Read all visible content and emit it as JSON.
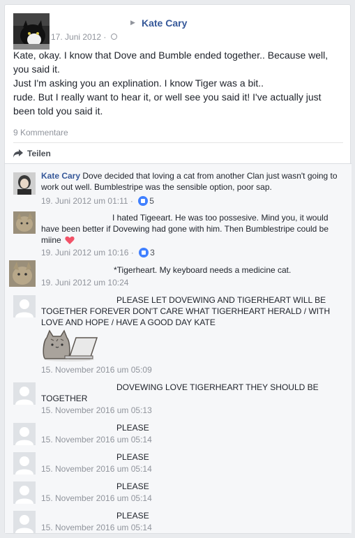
{
  "post": {
    "author": "Kate Cary",
    "date": "17. Juni 2012",
    "separator": "·",
    "body": [
      "Kate, okay. I know that Dove and Bumble ended together.. Because well, you said it.",
      "Just I'm asking you an explination. I know Tiger was a bit..",
      "rude. But I really want to hear it, or well see you said it! I've actually just been told you said it."
    ],
    "comment_count": "9 Kommentare",
    "share_label": "Teilen"
  },
  "comments": [
    {
      "author": "Kate Cary",
      "text": "Dove decided that loving a cat from another Clan just wasn't going to work out well. Bumblestripe was the sensible option, poor sap.",
      "time": "19. Juni 2012 um 01:11",
      "separator": "·",
      "likes": "5"
    },
    {
      "author": "",
      "text": "I hated Tigeeart. He was too possesive. Mind you, it would have been better if Dovewing had gone with him. Then Bumblestripe could be miine",
      "time": "19. Juni 2012 um 10:16",
      "separator": "·",
      "likes": "3"
    },
    {
      "author": "",
      "text": "*Tigerheart. My keyboard needs a medicine cat.",
      "time": "19. Juni 2012 um 10:24"
    },
    {
      "author": "",
      "text": "PLEASE LET DOVEWING AND TIGERHEART WILL BE TOGETHER FOREVER DON'T CARE WHAT TIGERHEART HERALD / WITH LOVE AND HOPE / HAVE A GOOD DAY KATE",
      "time": "15. November 2016 um 05:09"
    },
    {
      "author": "",
      "text": "DOVEWING LOVE TIGERHEART THEY SHOULD BE TOGETHER",
      "time": "15. November 2016 um 05:13"
    },
    {
      "author": "",
      "text": "PLEASE",
      "time": "15. November 2016 um 05:14"
    },
    {
      "author": "",
      "text": "PLEASE",
      "time": "15. November 2016 um 05:14"
    },
    {
      "author": "",
      "text": "PLEASE",
      "time": "15. November 2016 um 05:14"
    },
    {
      "author": "",
      "text": "PLEASE",
      "time": "15. November 2016 um 05:14"
    }
  ],
  "icons": {
    "post_author_arrow": "triangle-right-icon",
    "privacy": "globe-icon",
    "share": "share-arrow-icon",
    "like": "like-icon",
    "heart": "heart-icon",
    "sticker": "pusheen-laptop-sticker"
  },
  "colors": {
    "link": "#365899",
    "meta": "#90949c",
    "like": "#4080ff",
    "heart": "#f25268",
    "comments_bg": "#f6f7f9"
  }
}
